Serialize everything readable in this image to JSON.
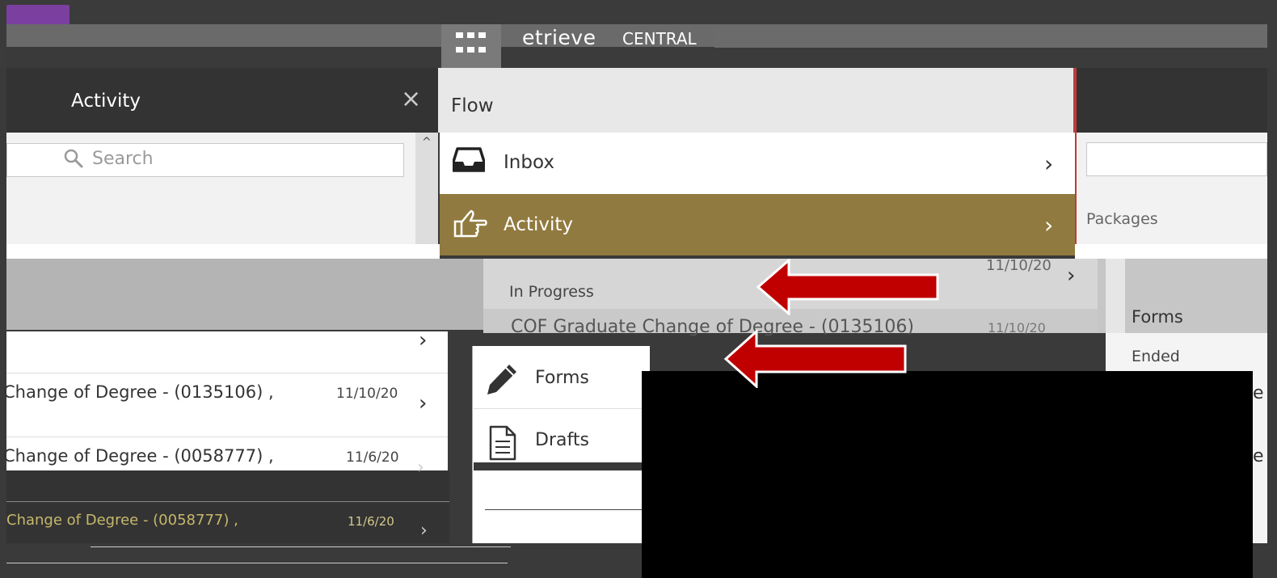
{
  "header": {
    "brand": "etrieve",
    "brand_sub": "CENTRAL"
  },
  "activity_panel": {
    "title": "Activity",
    "close_symbol": "×",
    "search_placeholder": "Search",
    "scroll_up_symbol": "^"
  },
  "flow_menu": {
    "title": "Flow",
    "items": [
      {
        "label": "Inbox",
        "icon": "inbox-icon",
        "chevron": "›"
      },
      {
        "label": "Activity",
        "icon": "thumbs-point-icon",
        "chevron": "›"
      }
    ]
  },
  "activity_list": {
    "in_progress_label": "In Progress",
    "top_item_date": "11/10/20",
    "top_item_chevron": "›",
    "cof_item": {
      "title": "COF Graduate Change of Degree - (0135106)",
      "date": "11/10/20"
    }
  },
  "left_list": {
    "rows": [
      {
        "text": "Change of Degree - (0135106) ,",
        "date": "11/10/20",
        "chevron": "›"
      },
      {
        "text": "Change of Degree - (0058777) ,",
        "date": "11/6/20",
        "chevron": "›"
      },
      {
        "text": "Change of Degree - (0058777) ,",
        "date": "11/6/20",
        "chevron": "›"
      }
    ],
    "first_row_chevron": "›"
  },
  "popup_menu": {
    "items": [
      {
        "label": "Forms",
        "icon": "pencil-icon"
      },
      {
        "label": "Drafts",
        "icon": "document-icon"
      }
    ]
  },
  "right_panel": {
    "packages_label": "Packages",
    "forms_header": "Forms",
    "ended_label": "Ended",
    "item_fragments": [
      "e",
      "e"
    ]
  },
  "colors": {
    "accent_gold": "#917a3f",
    "app_purple": "#7b3fa0",
    "annotation_red": "#c00000"
  }
}
